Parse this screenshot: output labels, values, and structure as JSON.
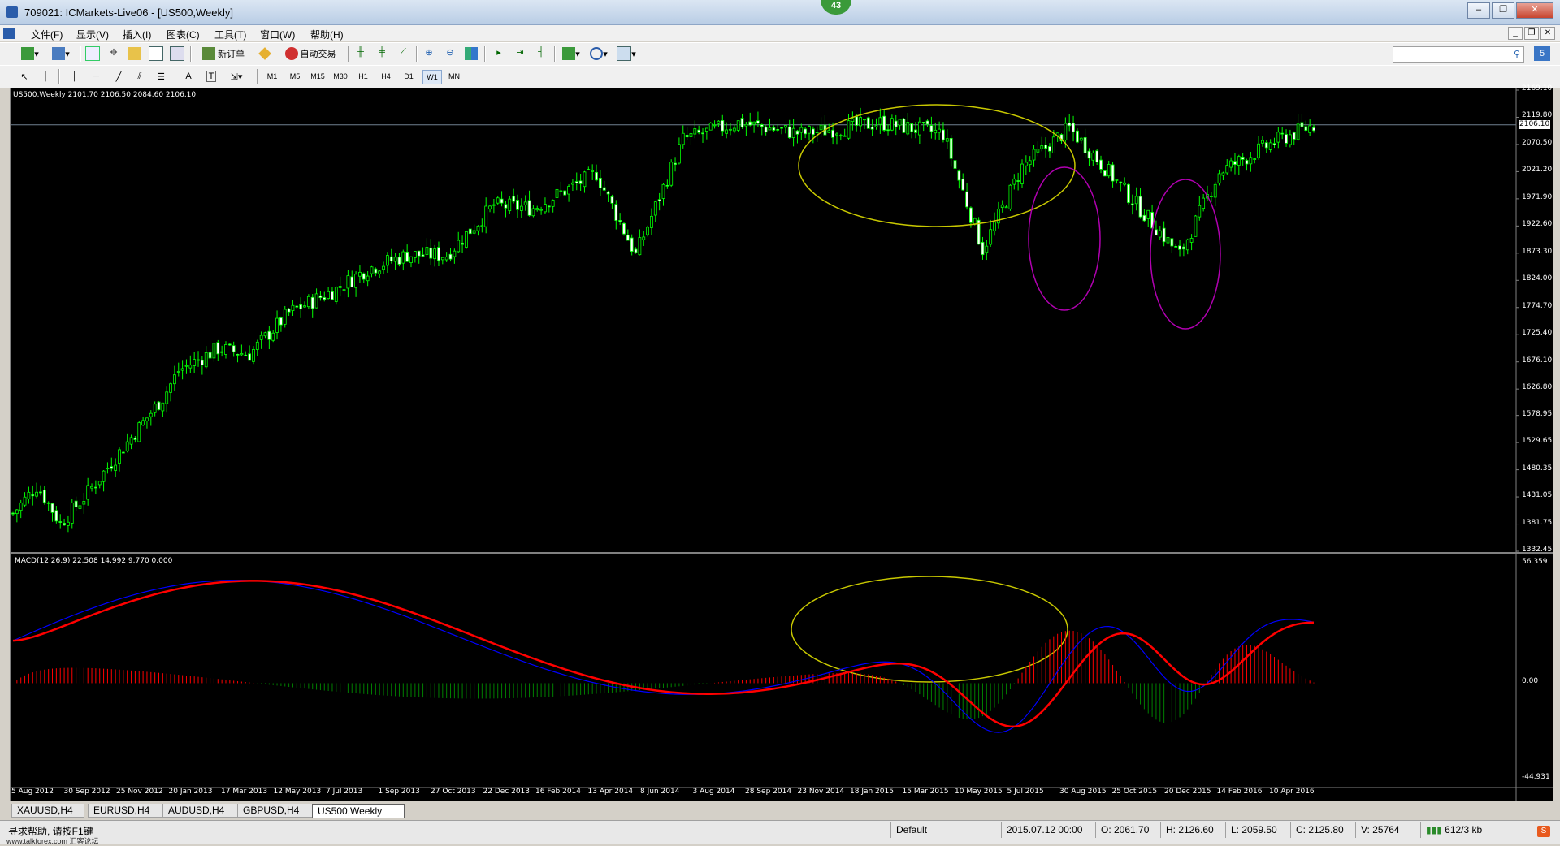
{
  "window": {
    "title": "709021: ICMarkets-Live06 - [US500,Weekly]",
    "badge": "43",
    "buttons": [
      "–",
      "❐",
      "✕"
    ]
  },
  "menu": [
    "文件(F)",
    "显示(V)",
    "插入(I)",
    "图表(C)",
    "工具(T)",
    "窗口(W)",
    "帮助(H)"
  ],
  "toolbar": {
    "new_order": "新订单",
    "auto_trading": "自动交易",
    "draw_text_tool": "A",
    "draw_label_tool": "T",
    "timeframes": [
      "M1",
      "M5",
      "M15",
      "M30",
      "H1",
      "H4",
      "D1",
      "W1",
      "MN"
    ],
    "active_timeframe": "W1"
  },
  "chart": {
    "main_header": "US500,Weekly  2101.70 2106.50 2084.60 2106.10",
    "macd_header": "MACD(12,26,9) 22.508 14.992 9.770 0.000",
    "price_ticks": [
      "2169.10",
      "2119.80",
      "2070.50",
      "2021.20",
      "1971.90",
      "1922.60",
      "1873.30",
      "1824.00",
      "1774.70",
      "1725.40",
      "1676.10",
      "1626.80",
      "1578.95",
      "1529.65",
      "1480.35",
      "1431.05",
      "1381.75",
      "1332.45"
    ],
    "current_price": "2106.10",
    "macd_ticks": [
      "56.359",
      "0.00",
      "-44.931"
    ],
    "date_ticks": [
      "5 Aug 2012",
      "30 Sep 2012",
      "25 Nov 2012",
      "20 Jan 2013",
      "17 Mar 2013",
      "12 May 2013",
      "7 Jul 2013",
      "1 Sep 2013",
      "27 Oct 2013",
      "22 Dec 2013",
      "16 Feb 2014",
      "13 Apr 2014",
      "8 Jun 2014",
      "3 Aug 2014",
      "28 Sep 2014",
      "23 Nov 2014",
      "18 Jan 2015",
      "15 Mar 2015",
      "10 May 2015",
      "5 Jul 2015",
      "30 Aug 2015",
      "25 Oct 2015",
      "20 Dec 2015",
      "14 Feb 2016",
      "10 Apr 2016"
    ],
    "colors": {
      "bull": "#00ff00",
      "bear": "#00ff00",
      "macd_signal": "#ff0000",
      "macd_line": "#0000ff",
      "hist_pos": "#ff0000",
      "hist_neg": "#008000",
      "ellipse_yellow": "#c8c800",
      "ellipse_magenta": "#b000b0"
    }
  },
  "chart_data": {
    "type": "candlestick",
    "symbol": "US500",
    "timeframe": "Weekly",
    "ylim": [
      1332.45,
      2169.1
    ],
    "last": {
      "open": 2101.7,
      "high": 2106.5,
      "low": 2084.6,
      "close": 2106.1
    },
    "trend_closes": [
      [
        0,
        1401
      ],
      [
        6,
        1451
      ],
      [
        8,
        1431
      ],
      [
        12,
        1383
      ],
      [
        18,
        1430
      ],
      [
        28,
        1521
      ],
      [
        38,
        1611
      ],
      [
        42,
        1660
      ],
      [
        52,
        1700
      ],
      [
        60,
        1690
      ],
      [
        70,
        1765
      ],
      [
        82,
        1808
      ],
      [
        90,
        1845
      ],
      [
        100,
        1870
      ],
      [
        110,
        1870
      ],
      [
        122,
        1960
      ],
      [
        132,
        1955
      ],
      [
        148,
        2018
      ],
      [
        158,
        1870
      ],
      [
        170,
        2080
      ],
      [
        184,
        2110
      ],
      [
        200,
        2090
      ],
      [
        220,
        2110
      ],
      [
        236,
        2090
      ],
      [
        246,
        1880
      ],
      [
        256,
        2030
      ],
      [
        268,
        2100
      ],
      [
        278,
        2020
      ],
      [
        290,
        1920
      ],
      [
        296,
        1870
      ],
      [
        306,
        2020
      ],
      [
        320,
        2075
      ],
      [
        330,
        2106
      ]
    ],
    "macd": {
      "ylim": [
        -44.931,
        56.359
      ]
    }
  },
  "tabs": [
    "XAUUSD,H4",
    "EURUSD,H4",
    "AUDUSD,H4",
    "GBPUSD,H4",
    "US500,Weekly"
  ],
  "active_tab": "US500,Weekly",
  "status": {
    "help": "寻求帮助, 请按F1键",
    "watermark": "www.talkforex.com 汇客论坛",
    "profile": "Default",
    "datetime": "2015.07.12 00:00",
    "open": "O: 2061.70",
    "high": "H: 2126.60",
    "low": "L: 2059.50",
    "close": "C: 2125.80",
    "volume": "V: 25764",
    "traffic": "612/3 kb"
  }
}
